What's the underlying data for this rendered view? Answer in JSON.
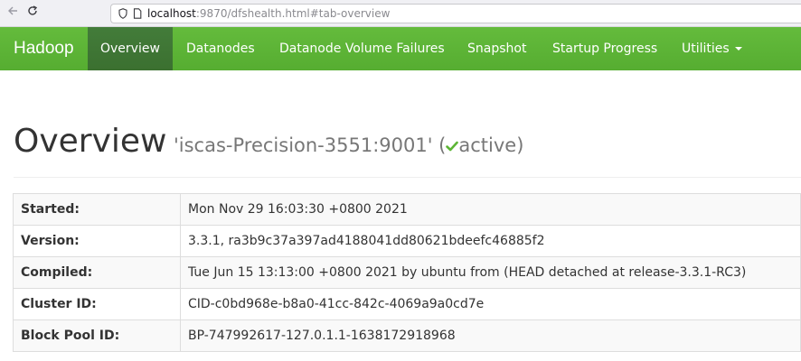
{
  "browser": {
    "url_host": "localhost",
    "url_rest": ":9870/dfshealth.html#tab-overview"
  },
  "navbar": {
    "brand": "Hadoop",
    "items": [
      {
        "label": "Overview",
        "active": true
      },
      {
        "label": "Datanodes",
        "active": false
      },
      {
        "label": "Datanode Volume Failures",
        "active": false
      },
      {
        "label": "Snapshot",
        "active": false
      },
      {
        "label": "Startup Progress",
        "active": false
      },
      {
        "label": "Utilities",
        "active": false,
        "dropdown": true
      }
    ]
  },
  "header": {
    "title": "Overview",
    "host": "'iscas-Precision-3551:9001'",
    "status_prefix": " (",
    "status": "active",
    "status_suffix": ")"
  },
  "overview": {
    "rows": [
      {
        "label": "Started:",
        "value": "Mon Nov 29 16:03:30 +0800 2021"
      },
      {
        "label": "Version:",
        "value": "3.3.1, ra3b9c37a397ad4188041dd80621bdeefc46885f2"
      },
      {
        "label": "Compiled:",
        "value": "Tue Jun 15 13:13:00 +0800 2021 by ubuntu from (HEAD detached at release-3.3.1-RC3)"
      },
      {
        "label": "Cluster ID:",
        "value": "CID-c0bd968e-b8a0-41cc-842c-4069a9a0cd7e"
      },
      {
        "label": "Block Pool ID:",
        "value": "BP-747992617-127.0.1.1-1638172918968"
      }
    ]
  },
  "colors": {
    "navbar_green": "#5cb535",
    "navbar_active": "#3d7a34",
    "check_green": "#5cb535"
  },
  "icons": {
    "back": "arrow-left-icon",
    "reload": "reload-icon",
    "shield": "shield-icon",
    "page": "page-icon",
    "check": "check-icon",
    "caret": "caret-down-icon"
  }
}
